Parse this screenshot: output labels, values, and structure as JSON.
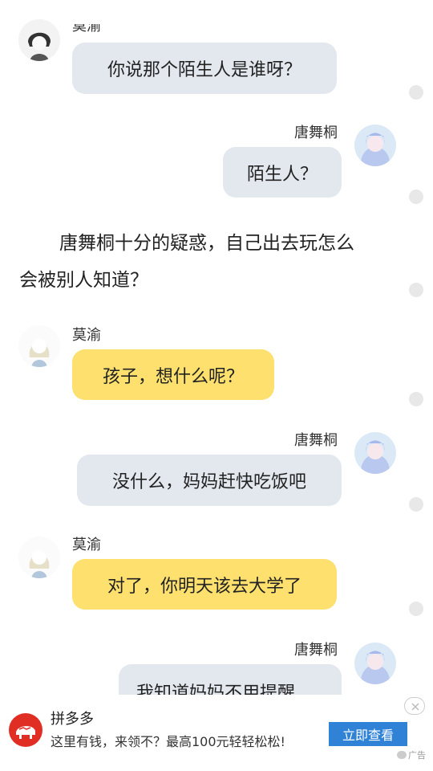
{
  "chat": {
    "msg1": {
      "sender": "莫渝",
      "text": "你说那个陌生人是谁呀？"
    },
    "msg2": {
      "sender": "唐舞桐",
      "text": "陌生人？"
    },
    "narration": {
      "line1": "唐舞桐十分的疑惑，自己出去玩怎么",
      "line2": "会被别人知道？"
    },
    "msg3": {
      "sender": "莫渝",
      "text": "孩子，想什么呢？"
    },
    "msg4": {
      "sender": "唐舞桐",
      "text": "没什么，妈妈赶快吃饭吧"
    },
    "msg5": {
      "sender": "莫渝",
      "text": "对了，你明天该去大学了"
    },
    "msg6": {
      "sender": "唐舞桐",
      "text": "我知道妈妈不用提醒"
    }
  },
  "ad": {
    "title": "拼多多",
    "desc": "这里有钱，来领不？最高100元轻轻松松!",
    "button": "立即查看",
    "label": "广告",
    "brand_color": "#e02e24",
    "button_color": "#2f82d6"
  },
  "colors": {
    "gray_bubble": "#e3e8ef",
    "yellow_bubble": "#fde06e"
  },
  "icons": {
    "avatar_moyu": "avatar",
    "avatar_tangwutong": "avatar",
    "close": "close-icon",
    "ad_label": "chat-icon"
  }
}
